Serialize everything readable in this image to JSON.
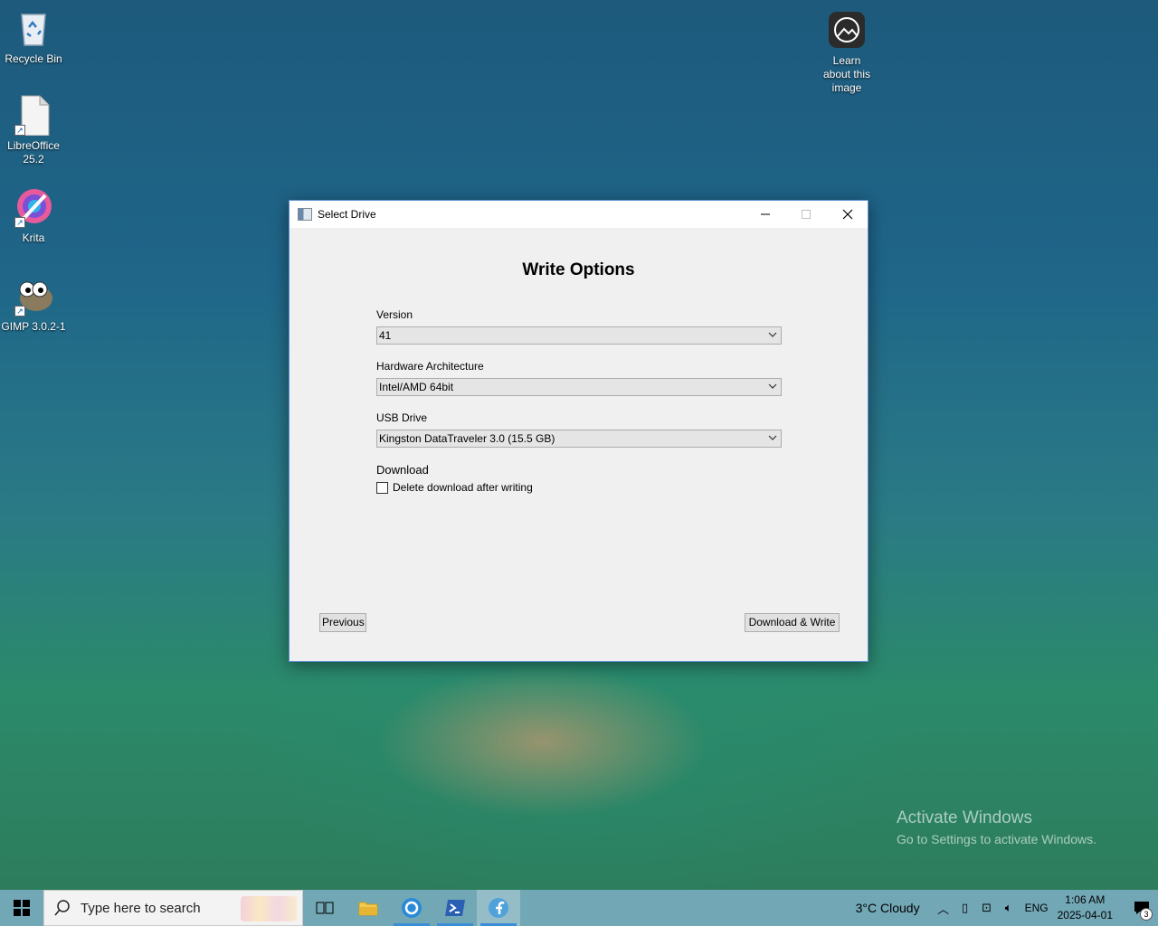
{
  "desktop": {
    "icons": [
      {
        "label": "Recycle Bin",
        "icon": "recycle-bin-icon"
      },
      {
        "label": "LibreOffice 25.2",
        "icon": "libreoffice-icon"
      },
      {
        "label": "Krita",
        "icon": "krita-icon"
      },
      {
        "label": "GIMP 3.0.2-1",
        "icon": "gimp-icon"
      },
      {
        "label": "Learn about this image",
        "icon": "camera-icon"
      }
    ],
    "watermark": {
      "title": "Activate Windows",
      "subtitle": "Go to Settings to activate Windows."
    }
  },
  "window": {
    "title": "Select Drive",
    "heading": "Write Options",
    "version": {
      "label": "Version",
      "value": "41"
    },
    "architecture": {
      "label": "Hardware Architecture",
      "value": "Intel/AMD 64bit"
    },
    "usb_drive": {
      "label": "USB Drive",
      "value": "Kingston DataTraveler 3.0 (15.5 GB)"
    },
    "download": {
      "label": "Download",
      "checkbox_label": "Delete download after writing",
      "checked": false
    },
    "buttons": {
      "previous": "Previous",
      "download_write": "Download & Write"
    }
  },
  "taskbar": {
    "search_placeholder": "Type here to search",
    "weather": "3°C  Cloudy",
    "language": "ENG",
    "time": "1:06 AM",
    "date": "2025-04-01",
    "notification_count": "3",
    "accent": "#3b8ed6"
  }
}
